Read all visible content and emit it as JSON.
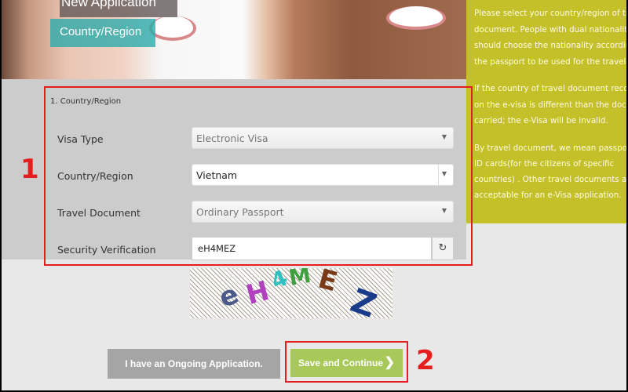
{
  "banner": {
    "heading": "New Application",
    "step_tab": "Country/Region"
  },
  "sidebar": {
    "paragraphs": [
      [
        "Please select your country/region of travel",
        "document. People with dual nationality",
        "should choose the nationality according to",
        "the passport to be used for the travel."
      ],
      [
        "If the country of travel document recorded",
        "on the e-visa is different than the document",
        "carried; the e-Visa will be invalid."
      ],
      [
        "By travel document, we mean passports and",
        "ID cards(for the citizens of specific",
        "countries) . Other travel documents are not",
        "acceptable for an e-Visa application."
      ]
    ]
  },
  "form": {
    "section_title": "1. Country/Region",
    "fields": [
      {
        "label": "Visa Type",
        "value": "Electronic Visa"
      },
      {
        "label": "Country/Region",
        "value": "Vietnam"
      },
      {
        "label": "Travel Document",
        "value": "Ordinary Passport"
      },
      {
        "label": "Security Verification",
        "value": "eH4MEZ"
      }
    ],
    "captcha_text": "eH4MEZ"
  },
  "annotations": {
    "marker1": "1",
    "marker2": "2",
    "highlight_color": "#e41e1e"
  },
  "buttons": {
    "ongoing": "I have an Ongoing Application.",
    "save": "Save and Continue"
  },
  "colors": {
    "sidebar": "#c4c02a",
    "save": "#a8c95a",
    "ongoing": "#a5a5a5",
    "tab": "#28aaaa"
  }
}
